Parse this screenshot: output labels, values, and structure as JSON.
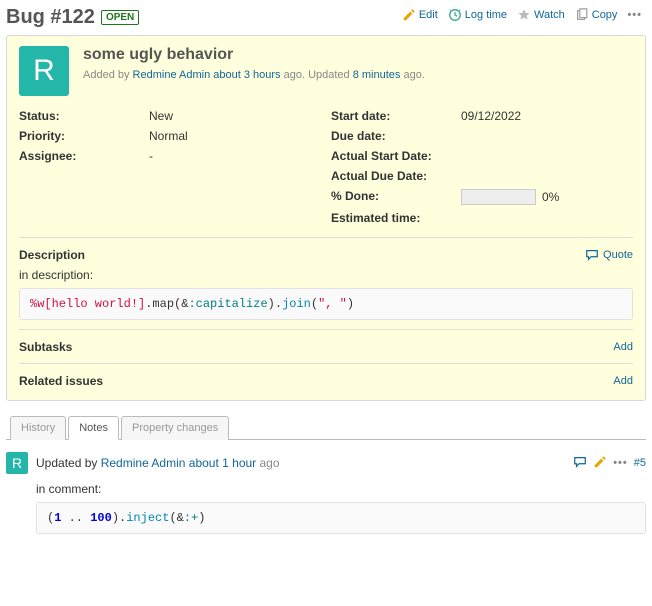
{
  "title": "Bug #122",
  "status_badge": "OPEN",
  "top_actions": {
    "edit": "Edit",
    "log_time": "Log time",
    "watch": "Watch",
    "copy": "Copy"
  },
  "avatar_letter": "R",
  "issue": {
    "subject": "some ugly behavior",
    "added_prefix": "Added by ",
    "author": "Redmine Admin",
    "created": "about 3 hours",
    "ago1": " ago. Updated ",
    "updated": "8 minutes",
    "ago2": " ago."
  },
  "attrs_left": {
    "status_l": "Status:",
    "status_v": "New",
    "priority_l": "Priority:",
    "priority_v": "Normal",
    "assignee_l": "Assignee:",
    "assignee_v": "-"
  },
  "attrs_right": {
    "start_l": "Start date:",
    "start_v": "09/12/2022",
    "due_l": "Due date:",
    "due_v": "",
    "asd_l": "Actual Start Date:",
    "asd_v": "",
    "add_l": "Actual Due Date:",
    "add_v": "",
    "done_l": "% Done:",
    "done_v": "0%",
    "est_l": "Estimated time:",
    "est_v": ""
  },
  "description": {
    "heading": "Description",
    "quote": "Quote",
    "intro": "in description:",
    "code": {
      "p1": "%w[hello world!]",
      "p2": ".map(&",
      "p3": ":capitalize",
      "p4": ").",
      "p5": "join",
      "p6": "(",
      "p7": "\", \"",
      "p8": ")"
    }
  },
  "subtasks": {
    "heading": "Subtasks",
    "add": "Add"
  },
  "related": {
    "heading": "Related issues",
    "add": "Add"
  },
  "tabs": {
    "history": "History",
    "notes": "Notes",
    "property": "Property changes"
  },
  "note": {
    "avatar_letter": "R",
    "prefix": "Updated by ",
    "author": "Redmine Admin",
    "when": "about 1 hour",
    "ago": " ago",
    "anchor": "#5",
    "intro": "in comment:",
    "code": {
      "p1": "(",
      "p2": "1",
      "p3": " .. ",
      "p4": "100",
      "p5": ").",
      "p6": "inject",
      "p7": "(&",
      "p8": ":+",
      "p9": ")"
    }
  }
}
